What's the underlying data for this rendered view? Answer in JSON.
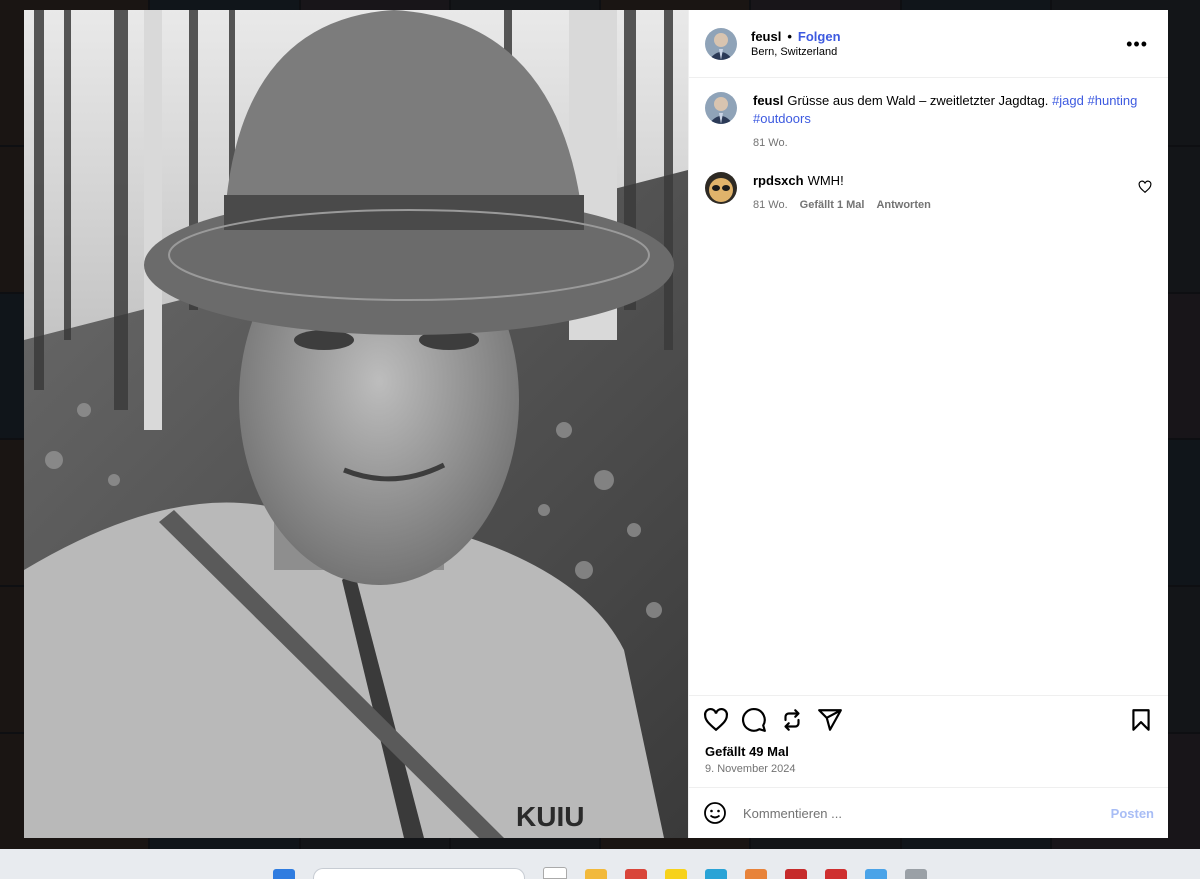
{
  "post": {
    "author": "feusl",
    "follow_label": "Folgen",
    "separator": "•",
    "location": "Bern, Switzerland",
    "more_label": "•••"
  },
  "caption": {
    "user": "feusl",
    "text": "Grüsse aus dem Wald – zweitletzter Jagdtag.",
    "hashtags": [
      "#jagd",
      "#hunting",
      "#outdoors"
    ],
    "age": "81 Wo."
  },
  "comments": [
    {
      "user": "rpdsxch",
      "text": "WMH!",
      "age": "81 Wo.",
      "likes": "Gefällt 1 Mal",
      "reply": "Antworten"
    }
  ],
  "stats": {
    "likes": "Gefällt 49 Mal",
    "date": "9. November 2024"
  },
  "composer": {
    "placeholder": "Kommentieren ...",
    "post_label": "Posten"
  },
  "photo": {
    "jacket_brand": "KUIU"
  },
  "icons": {
    "actions": [
      "heart-icon",
      "comment-icon",
      "repost-icon",
      "share-icon",
      "bookmark-icon"
    ],
    "composer": "emoji-icon"
  },
  "colors": {
    "link": "#3d5ae0",
    "post_button": "#a8bdf5",
    "muted": "#737373"
  }
}
